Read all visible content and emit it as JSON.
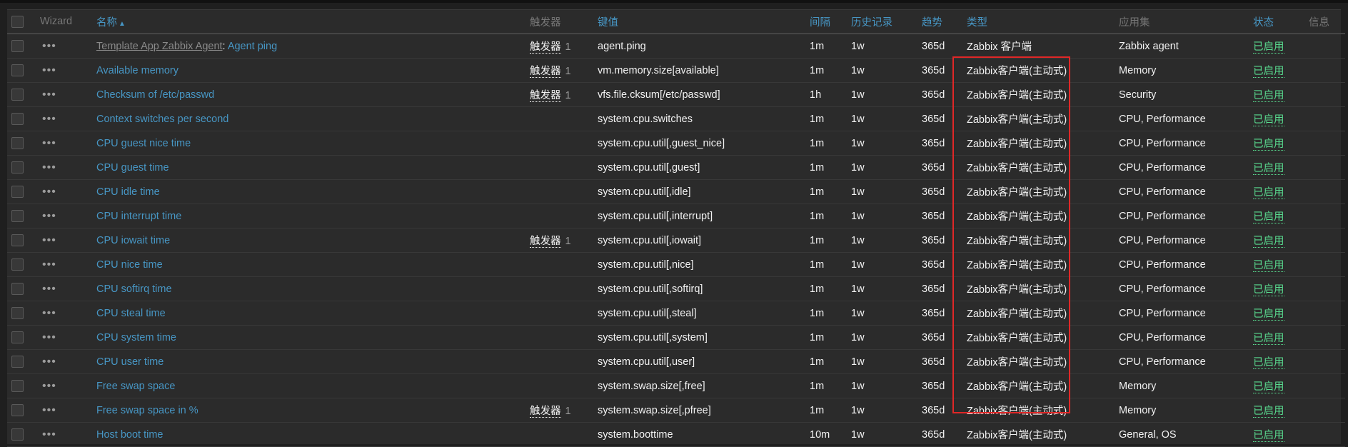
{
  "colors": {
    "background": "#1f1f1f",
    "table_bg": "#2b2b2b",
    "link": "#4796c4",
    "status_enabled": "#59db8f",
    "highlight": "#e02727",
    "muted_header": "#777777"
  },
  "icons": {
    "row_menu": "ellipsis-icon",
    "sort": "sort-asc-arrow-icon"
  },
  "header": {
    "wizard": "Wizard",
    "name": "名称",
    "sort_arrow": "▲",
    "triggers": "触发器",
    "key": "键值",
    "interval": "间隔",
    "history": "历史记录",
    "trends": "趋势",
    "type": "类型",
    "applications": "应用集",
    "status": "状态",
    "info": "信息"
  },
  "rows": [
    {
      "template": "Template App Zabbix Agent",
      "sep": ":",
      "name": "Agent ping",
      "triggers": "触发器",
      "trigger_count": "1",
      "key": "agent.ping",
      "interval": "1m",
      "history": "1w",
      "trends": "365d",
      "type": "Zabbix 客户端",
      "applications": "Zabbix agent",
      "status": "已启用"
    },
    {
      "name": "Available memory",
      "triggers": "触发器",
      "trigger_count": "1",
      "key": "vm.memory.size[available]",
      "interval": "1m",
      "history": "1w",
      "trends": "365d",
      "type": "Zabbix客户端(主动式)",
      "applications": "Memory",
      "status": "已启用"
    },
    {
      "name": "Checksum of /etc/passwd",
      "triggers": "触发器",
      "trigger_count": "1",
      "key": "vfs.file.cksum[/etc/passwd]",
      "interval": "1h",
      "history": "1w",
      "trends": "365d",
      "type": "Zabbix客户端(主动式)",
      "applications": "Security",
      "status": "已启用"
    },
    {
      "name": "Context switches per second",
      "key": "system.cpu.switches",
      "interval": "1m",
      "history": "1w",
      "trends": "365d",
      "type": "Zabbix客户端(主动式)",
      "applications": "CPU, Performance",
      "status": "已启用"
    },
    {
      "name": "CPU guest nice time",
      "key": "system.cpu.util[,guest_nice]",
      "interval": "1m",
      "history": "1w",
      "trends": "365d",
      "type": "Zabbix客户端(主动式)",
      "applications": "CPU, Performance",
      "status": "已启用"
    },
    {
      "name": "CPU guest time",
      "key": "system.cpu.util[,guest]",
      "interval": "1m",
      "history": "1w",
      "trends": "365d",
      "type": "Zabbix客户端(主动式)",
      "applications": "CPU, Performance",
      "status": "已启用"
    },
    {
      "name": "CPU idle time",
      "key": "system.cpu.util[,idle]",
      "interval": "1m",
      "history": "1w",
      "trends": "365d",
      "type": "Zabbix客户端(主动式)",
      "applications": "CPU, Performance",
      "status": "已启用"
    },
    {
      "name": "CPU interrupt time",
      "key": "system.cpu.util[,interrupt]",
      "interval": "1m",
      "history": "1w",
      "trends": "365d",
      "type": "Zabbix客户端(主动式)",
      "applications": "CPU, Performance",
      "status": "已启用"
    },
    {
      "name": "CPU iowait time",
      "triggers": "触发器",
      "trigger_count": "1",
      "key": "system.cpu.util[,iowait]",
      "interval": "1m",
      "history": "1w",
      "trends": "365d",
      "type": "Zabbix客户端(主动式)",
      "applications": "CPU, Performance",
      "status": "已启用"
    },
    {
      "name": "CPU nice time",
      "key": "system.cpu.util[,nice]",
      "interval": "1m",
      "history": "1w",
      "trends": "365d",
      "type": "Zabbix客户端(主动式)",
      "applications": "CPU, Performance",
      "status": "已启用"
    },
    {
      "name": "CPU softirq time",
      "key": "system.cpu.util[,softirq]",
      "interval": "1m",
      "history": "1w",
      "trends": "365d",
      "type": "Zabbix客户端(主动式)",
      "applications": "CPU, Performance",
      "status": "已启用"
    },
    {
      "name": "CPU steal time",
      "key": "system.cpu.util[,steal]",
      "interval": "1m",
      "history": "1w",
      "trends": "365d",
      "type": "Zabbix客户端(主动式)",
      "applications": "CPU, Performance",
      "status": "已启用"
    },
    {
      "name": "CPU system time",
      "key": "system.cpu.util[,system]",
      "interval": "1m",
      "history": "1w",
      "trends": "365d",
      "type": "Zabbix客户端(主动式)",
      "applications": "CPU, Performance",
      "status": "已启用"
    },
    {
      "name": "CPU user time",
      "key": "system.cpu.util[,user]",
      "interval": "1m",
      "history": "1w",
      "trends": "365d",
      "type": "Zabbix客户端(主动式)",
      "applications": "CPU, Performance",
      "status": "已启用"
    },
    {
      "name": "Free swap space",
      "key": "system.swap.size[,free]",
      "interval": "1m",
      "history": "1w",
      "trends": "365d",
      "type": "Zabbix客户端(主动式)",
      "applications": "Memory",
      "status": "已启用"
    },
    {
      "name": "Free swap space in %",
      "triggers": "触发器",
      "trigger_count": "1",
      "key": "system.swap.size[,pfree]",
      "interval": "1m",
      "history": "1w",
      "trends": "365d",
      "type": "Zabbix客户端(主动式)",
      "applications": "Memory",
      "status": "已启用"
    },
    {
      "name": "Host boot time",
      "key": "system.boottime",
      "interval": "10m",
      "history": "1w",
      "trends": "365d",
      "type": "Zabbix客户端(主动式)",
      "applications": "General, OS",
      "status": "已启用"
    }
  ]
}
